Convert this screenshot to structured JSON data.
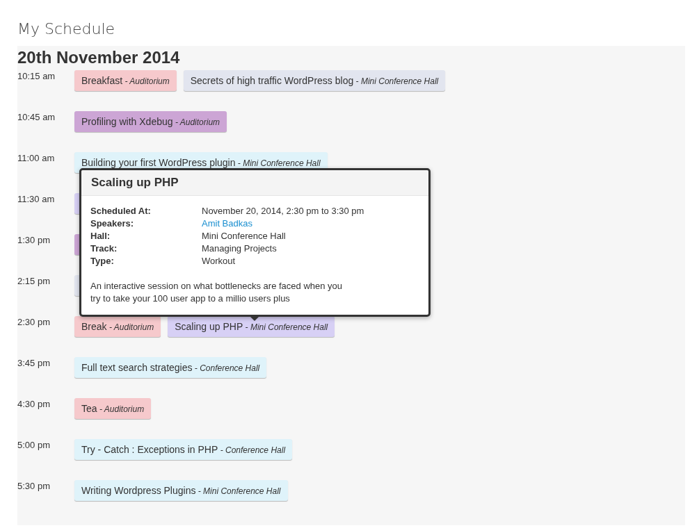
{
  "page_title": "My Schedule",
  "date": "20th November 2014",
  "slots": [
    {
      "time": "10:15 am",
      "sessions": [
        {
          "title": "Breakfast",
          "hall": "- Auditorium",
          "color": "#f6c9cc"
        },
        {
          "title": "Secrets of high traffic WordPress blog",
          "hall": "- Mini Conference Hall",
          "color": "#e2e5ef"
        }
      ]
    },
    {
      "time": "10:45 am",
      "sessions": [
        {
          "title": "Profiling with Xdebug",
          "hall": "- Auditorium",
          "color": "#cca5d5"
        }
      ]
    },
    {
      "time": "11:00 am",
      "sessions": [
        {
          "title": "Building your first WordPress plugin",
          "hall": "- Mini Conference Hall",
          "color": "#dff3fa"
        }
      ]
    },
    {
      "time": "11:30 am",
      "sessions": [
        {
          "color": "#d7d0f5"
        }
      ]
    },
    {
      "time": "1:30 pm",
      "sessions": [
        {
          "color": "#cca5d5"
        }
      ]
    },
    {
      "time": "2:15 pm",
      "sessions": [
        {
          "color": "#e2e5ef"
        }
      ]
    },
    {
      "time": "2:30 pm",
      "sessions": [
        {
          "title": "Break",
          "hall": "- Auditorium",
          "color": "#f6c9cc"
        },
        {
          "title": "Scaling up PHP",
          "hall": "- Mini Conference Hall",
          "color": "#d7d0f5"
        }
      ]
    },
    {
      "time": "3:45 pm",
      "sessions": [
        {
          "title": "Full text search strategies",
          "hall": "- Conference Hall",
          "color": "#dff3fa"
        }
      ]
    },
    {
      "time": "4:30 pm",
      "sessions": [
        {
          "title": "Tea",
          "hall": "- Auditorium",
          "color": "#f6c9cc"
        }
      ]
    },
    {
      "time": "5:00 pm",
      "sessions": [
        {
          "title": "Try - Catch : Exceptions in PHP",
          "hall": "- Conference Hall",
          "color": "#dff3fa"
        }
      ]
    },
    {
      "time": "5:30 pm",
      "sessions": [
        {
          "title": "Writing Wordpress Plugins",
          "hall": "- Mini Conference Hall",
          "color": "#dff3fa"
        }
      ]
    }
  ],
  "popover": {
    "title": "Scaling up PHP",
    "details": [
      {
        "label": "Scheduled At:",
        "value": "November 20, 2014, 2:30 pm to 3:30 pm",
        "kind": "text"
      },
      {
        "label": "Speakers:",
        "value": "Amit Badkas",
        "kind": "link"
      },
      {
        "label": "Hall:",
        "value": "Mini Conference Hall",
        "kind": "text"
      },
      {
        "label": "Track:",
        "value": "Managing Projects",
        "kind": "text"
      },
      {
        "label": "Type:",
        "value": "Workout",
        "kind": "text"
      }
    ],
    "description": [
      "An interactive session on what bottlenecks are faced when you",
      "try to take your 100 user app to a millio users plus"
    ]
  }
}
